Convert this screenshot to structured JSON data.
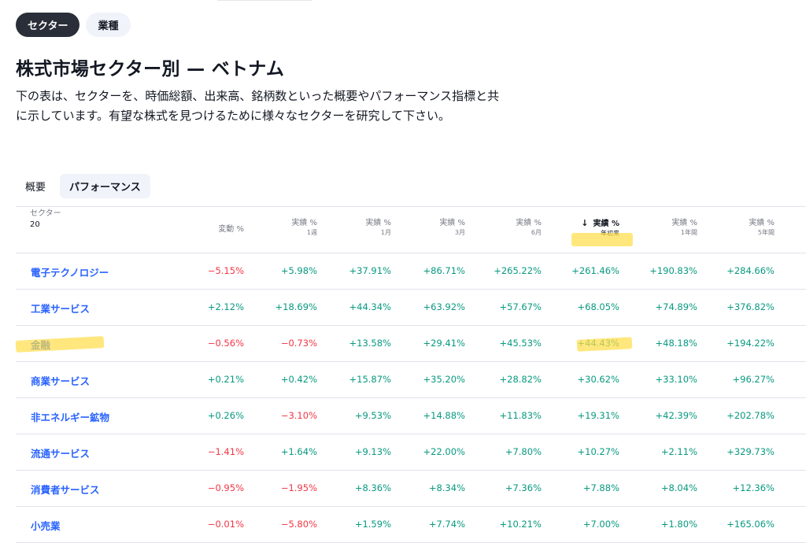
{
  "pills": [
    {
      "label": "セクター",
      "active": true
    },
    {
      "label": "業種",
      "active": false
    }
  ],
  "title": "株式市場セクター別 — ベトナム",
  "description": "下の表は、セクターを、時価総額、出来高、銘柄数といった概要やパフォーマンス指標と共に示しています。有望な株式を見つけるために様々なセクターを研究して下さい。",
  "tabs": [
    {
      "label": "概要",
      "active": false
    },
    {
      "label": "パフォーマンス",
      "active": true
    }
  ],
  "table": {
    "sector_header": "セクター",
    "sector_count": "20",
    "columns": [
      {
        "label": "変動 %",
        "sub": ""
      },
      {
        "label": "実績 %",
        "sub": "1週"
      },
      {
        "label": "実績 %",
        "sub": "1月"
      },
      {
        "label": "実績 %",
        "sub": "3月"
      },
      {
        "label": "実績 %",
        "sub": "6月"
      },
      {
        "label": "実績 %",
        "sub": "年初来",
        "sorted": true
      },
      {
        "label": "実績 %",
        "sub": "1年間"
      },
      {
        "label": "実績 %",
        "sub": "5年間"
      }
    ],
    "rows": [
      {
        "name": "電子テクノロジー",
        "values": [
          "−5.15%",
          "+5.98%",
          "+37.91%",
          "+86.71%",
          "+265.22%",
          "+261.46%",
          "+190.83%",
          "+284.66%"
        ]
      },
      {
        "name": "工業サービス",
        "values": [
          "+2.12%",
          "+18.69%",
          "+44.34%",
          "+63.92%",
          "+57.67%",
          "+68.05%",
          "+74.89%",
          "+376.82%"
        ]
      },
      {
        "name": "金融",
        "values": [
          "−0.56%",
          "−0.73%",
          "+13.58%",
          "+29.41%",
          "+45.53%",
          "+44.43%",
          "+48.18%",
          "+194.22%"
        ]
      },
      {
        "name": "商業サービス",
        "values": [
          "+0.21%",
          "+0.42%",
          "+15.87%",
          "+35.20%",
          "+28.82%",
          "+30.62%",
          "+33.10%",
          "+96.27%"
        ]
      },
      {
        "name": "非エネルギー鉱物",
        "values": [
          "+0.26%",
          "−3.10%",
          "+9.53%",
          "+14.88%",
          "+11.83%",
          "+19.31%",
          "+42.39%",
          "+202.78%"
        ]
      },
      {
        "name": "流通サービス",
        "values": [
          "−1.41%",
          "+1.64%",
          "+9.13%",
          "+22.00%",
          "+7.80%",
          "+10.27%",
          "+2.11%",
          "+329.73%"
        ]
      },
      {
        "name": "消費者サービス",
        "values": [
          "−0.95%",
          "−1.95%",
          "+8.36%",
          "+8.34%",
          "+7.36%",
          "+7.88%",
          "+8.04%",
          "+12.36%"
        ]
      },
      {
        "name": "小売業",
        "values": [
          "−0.01%",
          "−5.80%",
          "+1.59%",
          "+7.74%",
          "+10.21%",
          "+7.00%",
          "+1.80%",
          "+165.06%"
        ]
      }
    ]
  },
  "colors": {
    "positive": "#089981",
    "negative": "#f23645",
    "link": "#2962ff",
    "highlight": "#ffdd46"
  },
  "icons": {
    "sort": "arrow-down-icon"
  }
}
